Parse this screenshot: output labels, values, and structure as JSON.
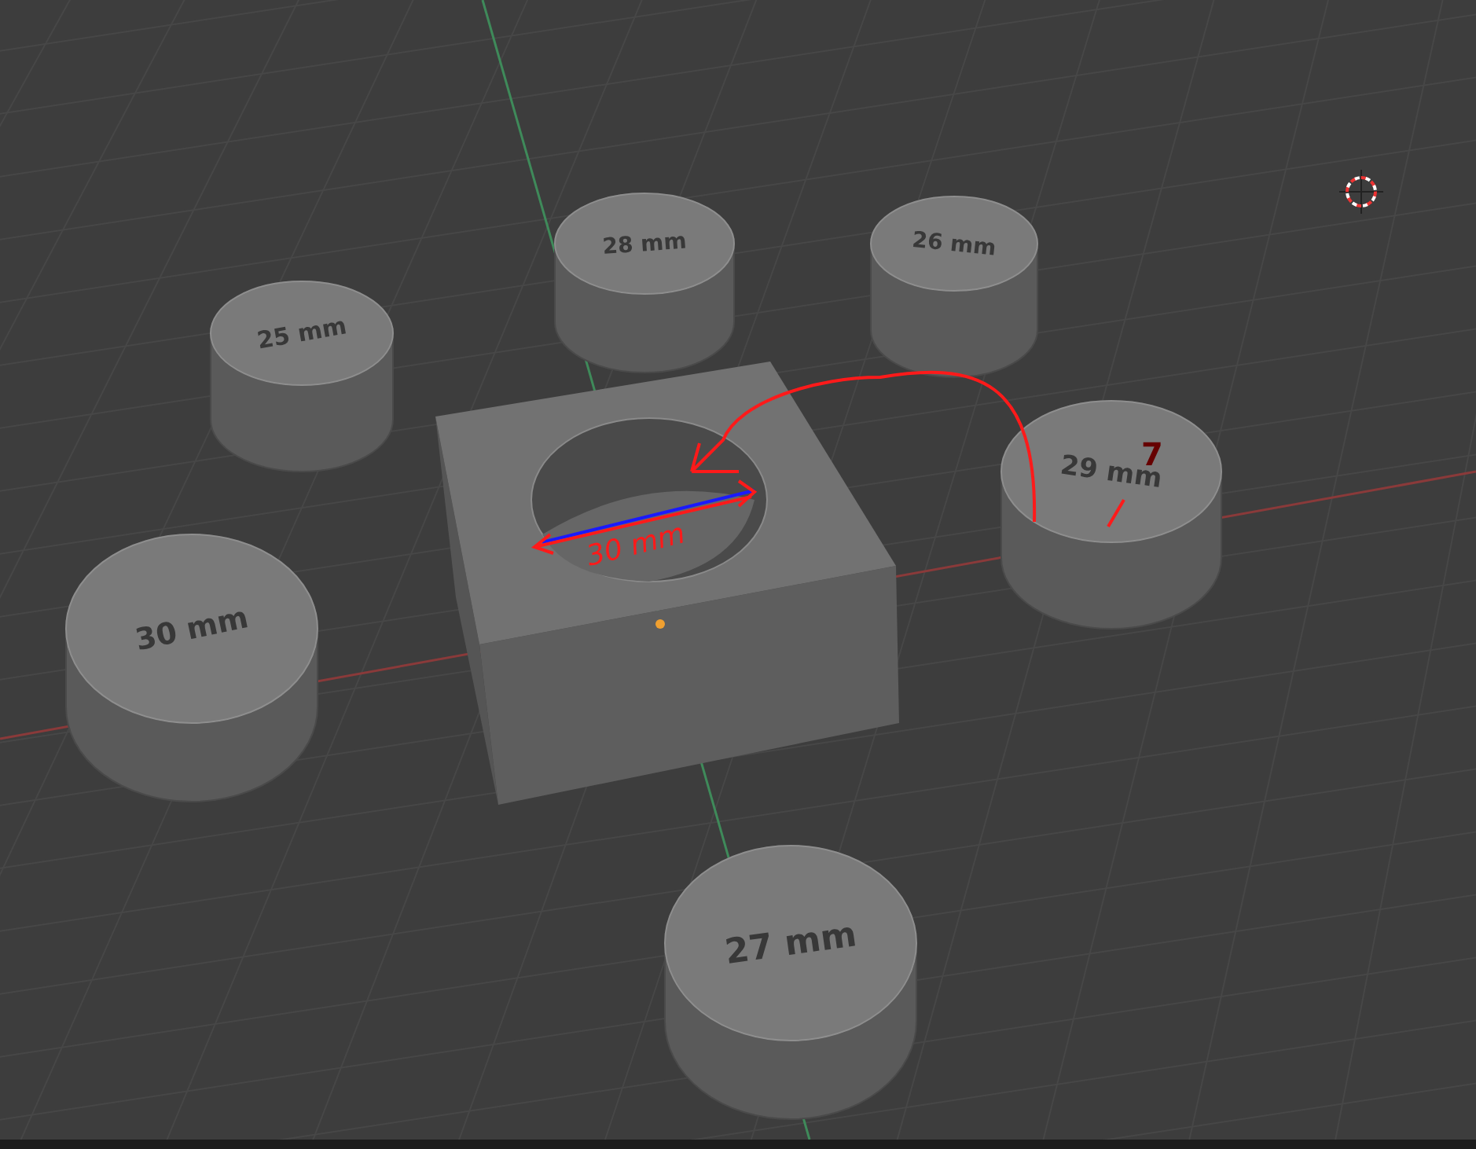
{
  "viewport": {
    "objects": [
      {
        "kind": "cylinder",
        "label": "25 mm"
      },
      {
        "kind": "cylinder",
        "label": "28 mm"
      },
      {
        "kind": "cylinder",
        "label": "26 mm"
      },
      {
        "kind": "block"
      },
      {
        "kind": "cylinder",
        "label": "29 mm"
      },
      {
        "kind": "cylinder",
        "label": "30 mm"
      },
      {
        "kind": "cylinder",
        "label": "27 mm"
      }
    ],
    "annotations": [
      "30 mm",
      "7"
    ]
  }
}
